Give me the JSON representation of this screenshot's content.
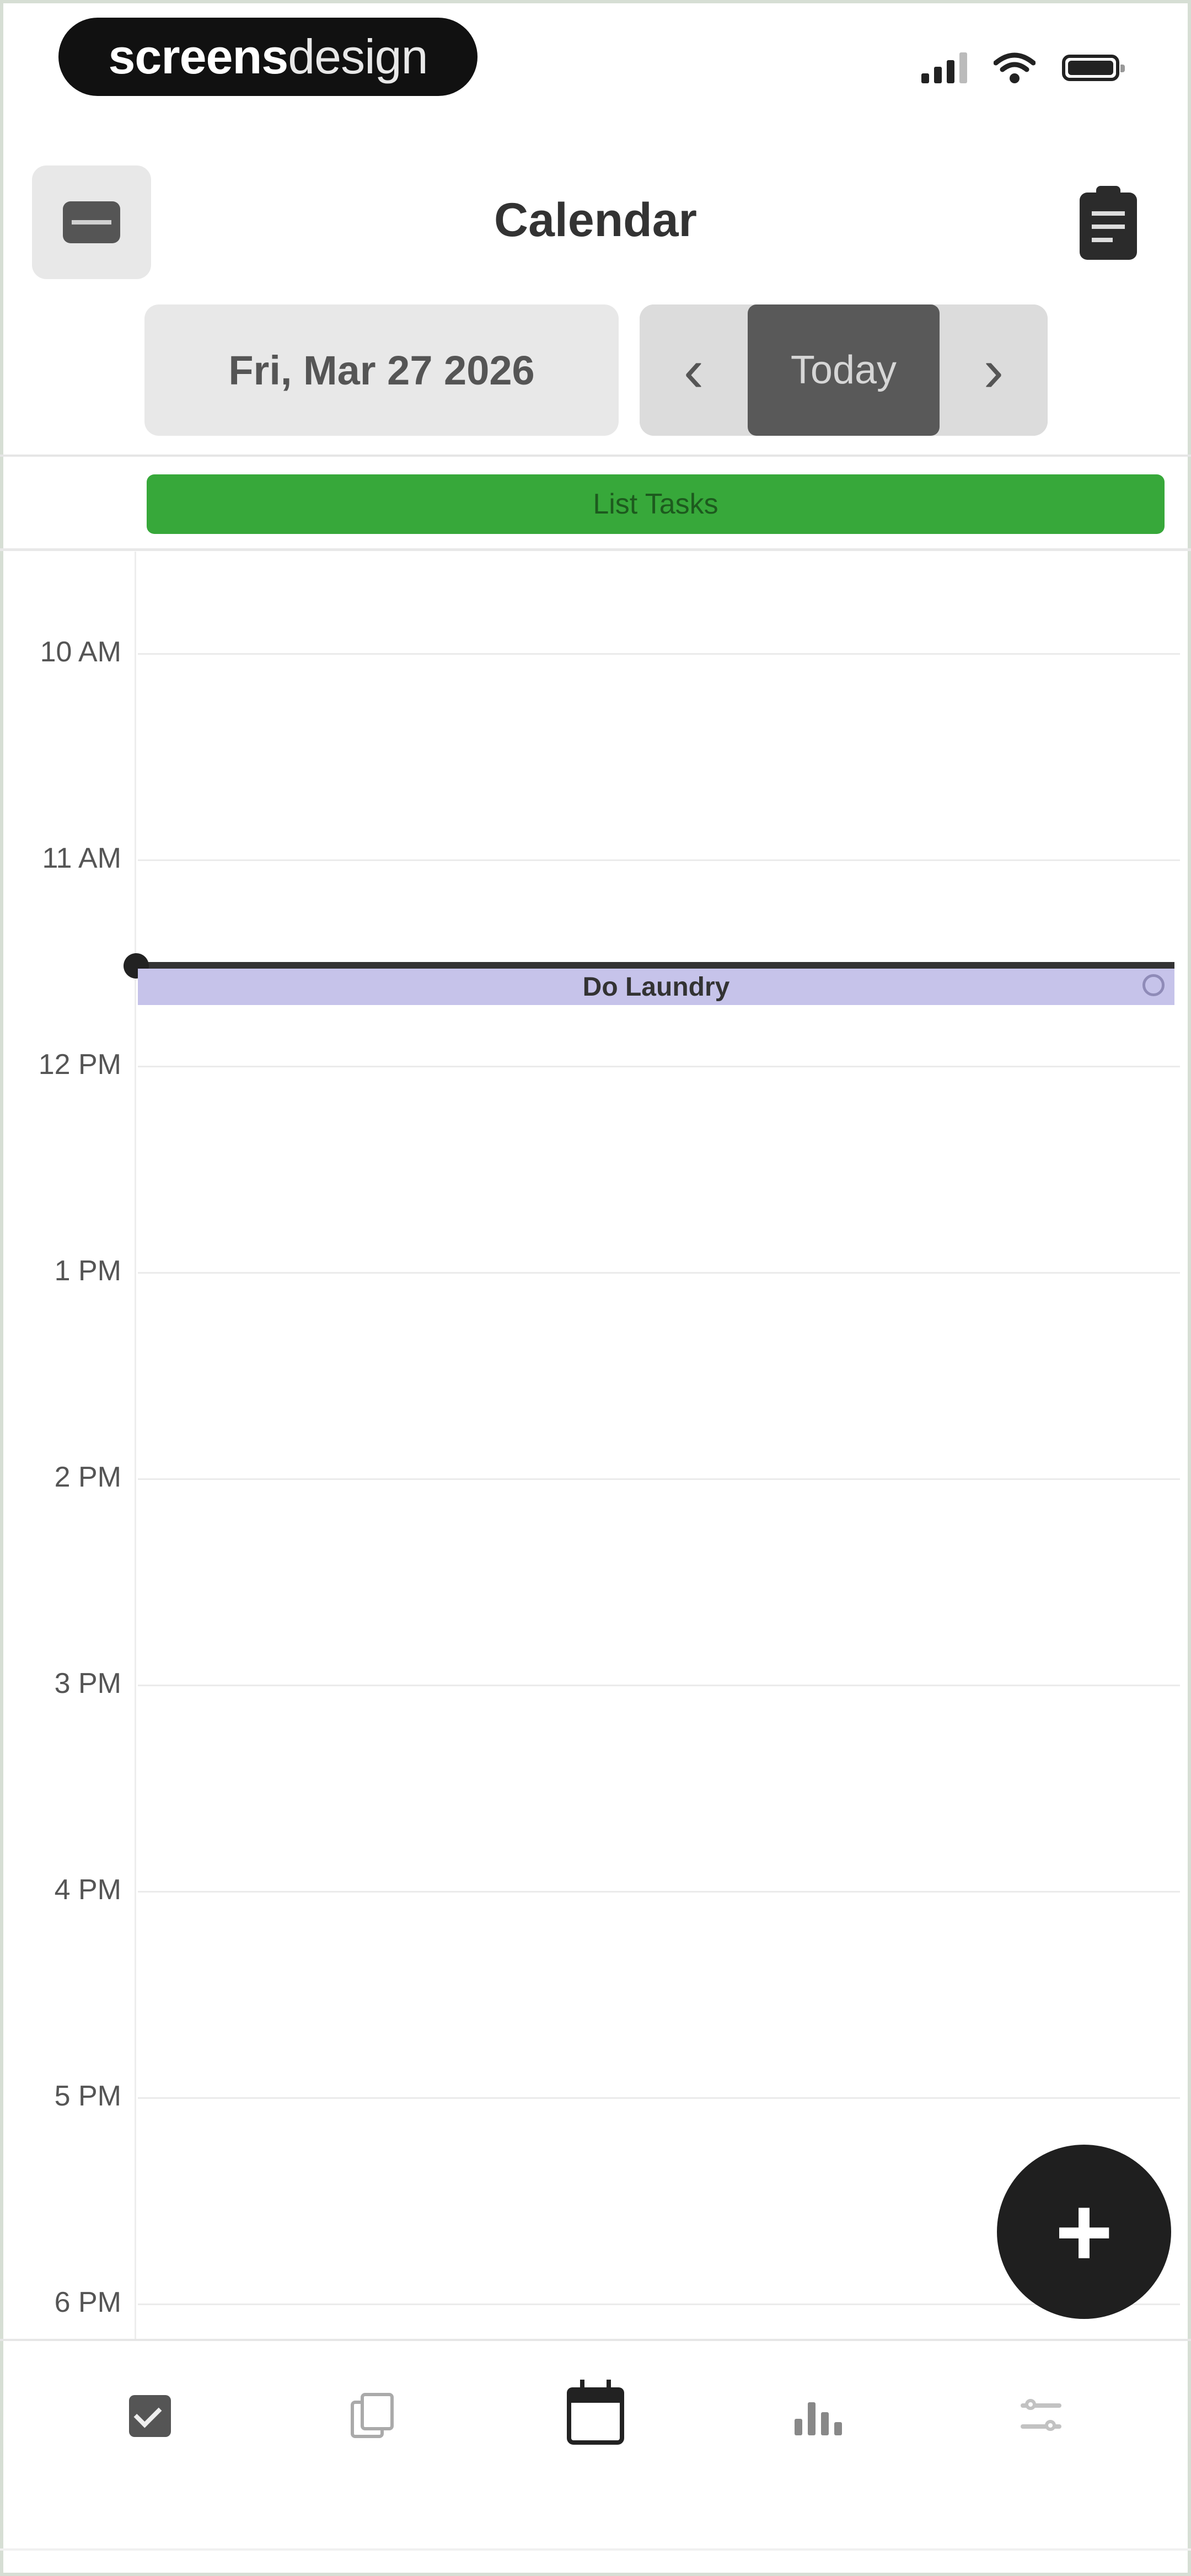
{
  "status_bar": {
    "brand_bold": "screens",
    "brand_light": "design",
    "icons": [
      "cellular-signal-icon",
      "wifi-icon",
      "battery-icon"
    ]
  },
  "header": {
    "title": "Calendar",
    "menu_icon": "menu-icon",
    "tasks_icon": "clipboard-icon"
  },
  "date_nav": {
    "current_date": "Fri, Mar 27 2026",
    "prev_glyph": "‹",
    "today_label": "Today",
    "next_glyph": "›"
  },
  "all_day": {
    "event_label": "List Tasks",
    "event_color": "#37a83a"
  },
  "timeline": {
    "hours": [
      "10 AM",
      "11 AM",
      "12 PM",
      "1 PM",
      "2 PM",
      "3 PM",
      "4 PM",
      "5 PM",
      "6 PM"
    ],
    "events": [
      {
        "title": "Do Laundry",
        "color": "#c6c3ea",
        "icon": "circle-outline-icon"
      }
    ]
  },
  "fab": {
    "label": "+",
    "icon": "plus-icon"
  },
  "bottom_nav": {
    "tabs": [
      {
        "icon": "checkbox-icon",
        "active": false
      },
      {
        "icon": "notes-icon",
        "active": false
      },
      {
        "icon": "calendar-icon",
        "active": true
      },
      {
        "icon": "stats-icon",
        "active": false
      },
      {
        "icon": "settings-icon",
        "active": false
      }
    ]
  }
}
